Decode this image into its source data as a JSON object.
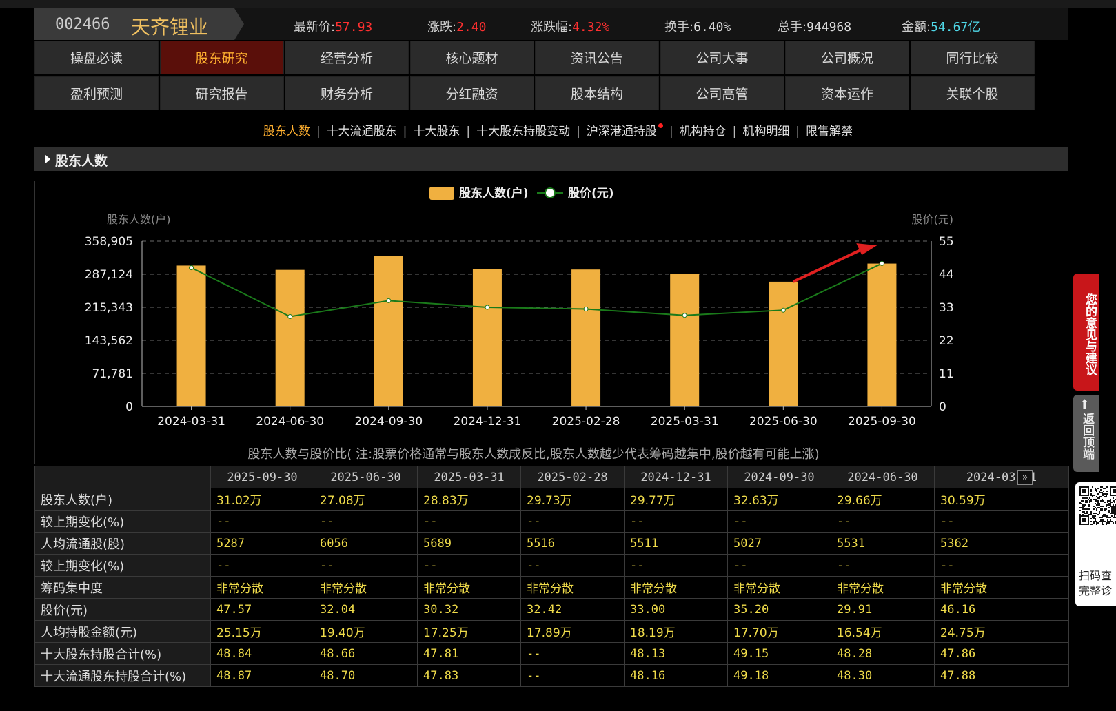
{
  "stock": {
    "code": "002466",
    "name": "天齐锂业",
    "quotes": [
      {
        "label": "最新价:",
        "value": "57.93",
        "style": "red"
      },
      {
        "label": "涨跌:",
        "value": "2.40",
        "style": "red"
      },
      {
        "label": "涨跌幅:",
        "value": "4.32%",
        "style": "red"
      },
      {
        "label": "换手:",
        "value": "6.40%",
        "style": "white"
      },
      {
        "label": "总手:",
        "value": "944968",
        "style": "white"
      },
      {
        "label": "金额:",
        "value": "54.67亿",
        "style": "cyan"
      }
    ]
  },
  "nav": {
    "row1": [
      "操盘必读",
      "股东研究",
      "经营分析",
      "核心题材",
      "资讯公告",
      "公司大事",
      "公司概况",
      "同行比较"
    ],
    "row2": [
      "盈利预测",
      "研究报告",
      "财务分析",
      "分红融资",
      "股本结构",
      "公司高管",
      "资本运作",
      "关联个股"
    ],
    "active": "股东研究"
  },
  "subnav": {
    "items": [
      "股东人数",
      "十大流通股东",
      "十大股东",
      "十大股东持股变动",
      "沪深港通持股",
      "机构持仓",
      "机构明细",
      "限售解禁"
    ],
    "active": "股东人数",
    "dot_item": "沪深港通持股"
  },
  "section": {
    "title": "股东人数"
  },
  "chart_data": {
    "type": "bar",
    "legend": [
      "股东人数(户)",
      "股价(元)"
    ],
    "left_axis_title": "股东人数(户)",
    "right_axis_title": "股价(元)",
    "categories": [
      "2024-03-31",
      "2024-06-30",
      "2024-09-30",
      "2024-12-31",
      "2025-02-28",
      "2025-03-31",
      "2025-06-30",
      "2025-09-30"
    ],
    "left_ticks": [
      "0",
      "71,781",
      "143,562",
      "215,343",
      "287,124",
      "358,905"
    ],
    "right_ticks": [
      "0",
      "11",
      "22",
      "33",
      "44",
      "55"
    ],
    "ylim_left": [
      0,
      358905
    ],
    "ylim_right": [
      0,
      55
    ],
    "series": [
      {
        "name": "股东人数(户)",
        "kind": "bar",
        "color": "#f0b040",
        "values": [
          305900,
          296600,
          326300,
          297700,
          297300,
          288300,
          270800,
          310200
        ]
      },
      {
        "name": "股价(元)",
        "kind": "line",
        "color": "#1a7a1a",
        "values": [
          46.16,
          29.91,
          35.2,
          33.0,
          32.42,
          30.32,
          32.04,
          47.57
        ]
      }
    ],
    "note": "股东人数与股价比( 注:股票价格通常与股东人数成反比,股东人数越少代表筹码越集中,股价越有可能上涨)",
    "grid": true,
    "legend_position": "top-center",
    "annotation": "red arrow pointing up-right near 2025-09-30"
  },
  "table": {
    "columns": [
      "2025-09-30",
      "2025-06-30",
      "2025-03-31",
      "2025-02-28",
      "2024-12-31",
      "2024-09-30",
      "2024-06-30",
      "2024-03-31"
    ],
    "rows": [
      {
        "label": "股东人数(户)",
        "values": [
          "31.02万",
          "27.08万",
          "28.83万",
          "29.73万",
          "29.77万",
          "32.63万",
          "29.66万",
          "30.59万"
        ],
        "cn": true
      },
      {
        "label": "较上期变化(%)",
        "values": [
          "--",
          "--",
          "--",
          "--",
          "--",
          "--",
          "--",
          "--"
        ]
      },
      {
        "label": "人均流通股(股)",
        "values": [
          "5287",
          "6056",
          "5689",
          "5516",
          "5511",
          "5027",
          "5531",
          "5362"
        ]
      },
      {
        "label": "较上期变化(%)",
        "values": [
          "--",
          "--",
          "--",
          "--",
          "--",
          "--",
          "--",
          "--"
        ]
      },
      {
        "label": "筹码集中度",
        "values": [
          "非常分散",
          "非常分散",
          "非常分散",
          "非常分散",
          "非常分散",
          "非常分散",
          "非常分散",
          "非常分散"
        ],
        "cn": true
      },
      {
        "label": "股价(元)",
        "values": [
          "47.57",
          "32.04",
          "30.32",
          "32.42",
          "33.00",
          "35.20",
          "29.91",
          "46.16"
        ]
      },
      {
        "label": "人均持股金额(元)",
        "values": [
          "25.15万",
          "19.40万",
          "17.25万",
          "17.89万",
          "18.19万",
          "17.70万",
          "16.54万",
          "24.75万"
        ],
        "cn": true
      },
      {
        "label": "十大股东持股合计(%)",
        "values": [
          "48.84",
          "48.66",
          "47.81",
          "--",
          "48.13",
          "49.15",
          "48.28",
          "47.86"
        ]
      },
      {
        "label": "十大流通股东持股合计(%)",
        "values": [
          "48.87",
          "48.70",
          "47.83",
          "--",
          "48.16",
          "49.18",
          "48.30",
          "47.88"
        ]
      }
    ],
    "more_icon": "double-chevron-right-icon"
  },
  "side": {
    "feedback": "您的意见与建议",
    "back_top": "返回顶端",
    "qr_text_1": "扫码查",
    "qr_text_2": "完整诊"
  },
  "colors": {
    "accent": "#ffb030",
    "up": "#ff3030",
    "value": "#f0dc4a",
    "active_tab": "#5a0f0a"
  }
}
